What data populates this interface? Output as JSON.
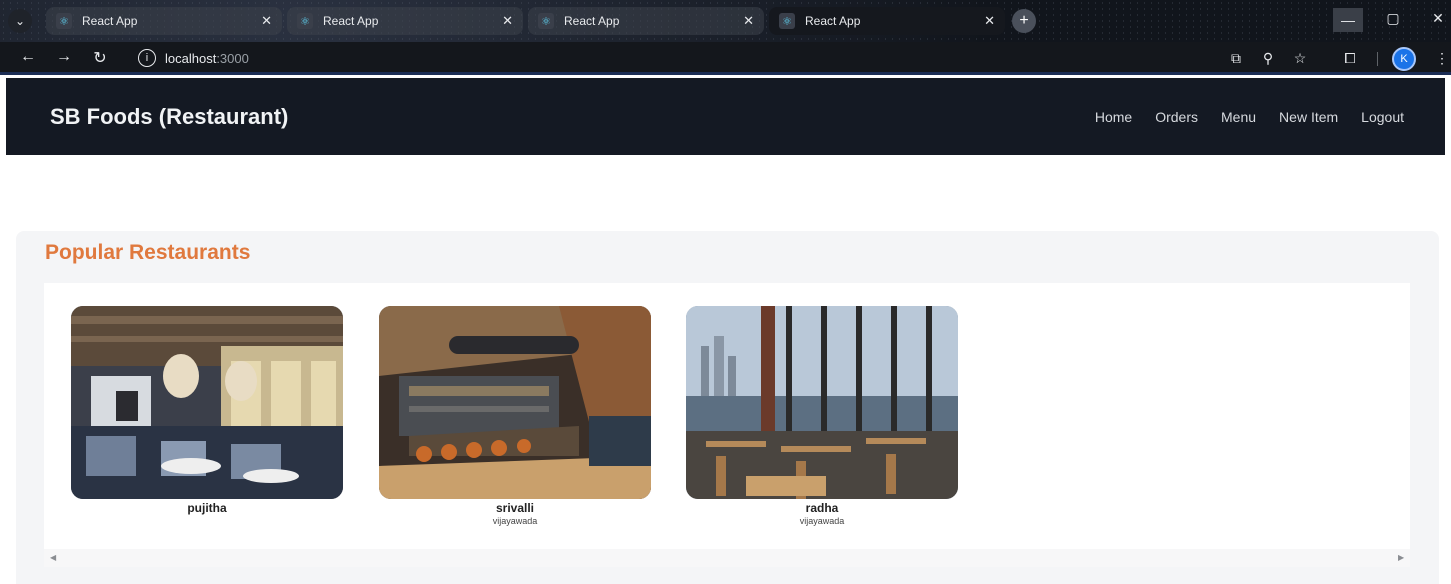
{
  "browser": {
    "tabs": [
      {
        "title": "React App",
        "active": false
      },
      {
        "title": "React App",
        "active": false
      },
      {
        "title": "React App",
        "active": false
      },
      {
        "title": "React App",
        "active": true
      }
    ],
    "url_host": "localhost",
    "url_port": ":3000",
    "profile_initial": "K",
    "icons": {
      "back": "arrow-left-icon",
      "forward": "arrow-right-icon",
      "reload": "reload-icon",
      "site_info": "info-icon",
      "install": "install-app-icon",
      "zoom": "zoom-icon",
      "bookmark": "star-icon",
      "extensions": "puzzle-icon",
      "menu": "kebab-menu-icon"
    }
  },
  "navbar": {
    "brand": "SB Foods (Restaurant)",
    "links": [
      "Home",
      "Orders",
      "Menu",
      "New Item",
      "Logout"
    ]
  },
  "popular": {
    "title": "Popular Restaurants",
    "restaurants": [
      {
        "name": "pujitha",
        "city": ""
      },
      {
        "name": "srivalli",
        "city": "vijayawada"
      },
      {
        "name": "radha",
        "city": "vijayawada"
      }
    ]
  },
  "colors": {
    "accent": "#e0793e",
    "navbar_bg": "#141923",
    "section_bg": "#f4f5f7"
  }
}
